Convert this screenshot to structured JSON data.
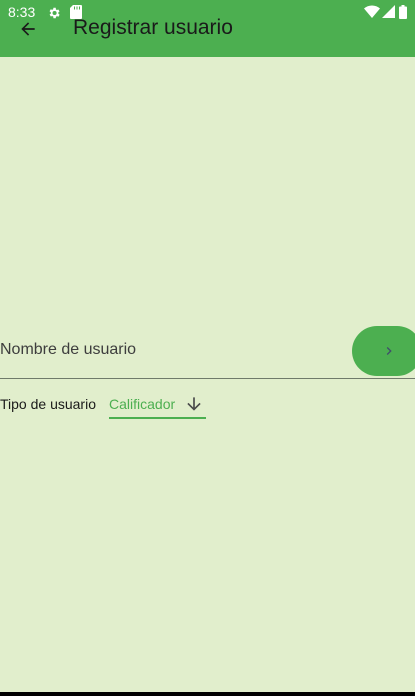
{
  "status_bar": {
    "time": "8:33",
    "icons": [
      "settings-icon",
      "sd-card-icon",
      "wifi-icon",
      "signal-icon",
      "battery-icon"
    ]
  },
  "app_bar": {
    "title": "Registrar usuario",
    "back_icon": "arrow-back-icon"
  },
  "form": {
    "username_placeholder": "Nombre de usuario",
    "next_icon": "chevron-right-icon",
    "user_type_label": "Tipo de usuario",
    "user_type_value": "Calificador",
    "dropdown_icon": "arrow-down-icon"
  },
  "colors": {
    "primary": "#4caf50",
    "background": "#e1eecc",
    "text": "#1a1a1a"
  }
}
